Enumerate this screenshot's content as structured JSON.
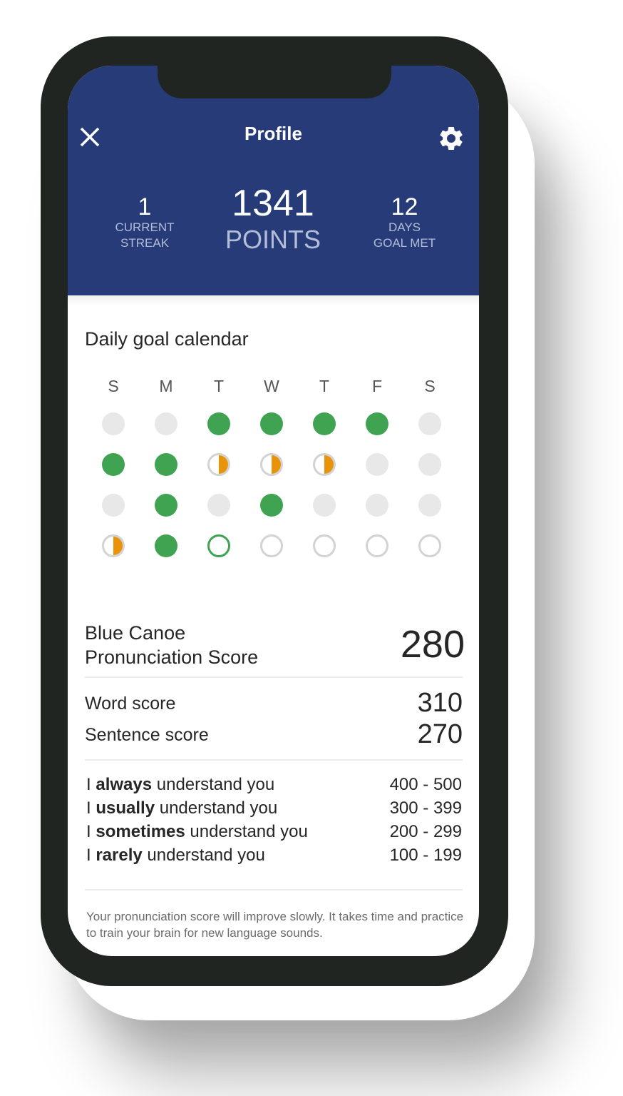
{
  "header": {
    "title": "Profile",
    "close_icon": "close-icon",
    "settings_icon": "gear-icon",
    "background_color": "#263b77"
  },
  "stats": {
    "streak": {
      "value": "1",
      "label_line1": "CURRENT",
      "label_line2": "STREAK"
    },
    "points": {
      "value": "1341",
      "label": "POINTS"
    },
    "days": {
      "value": "12",
      "label_line1": "DAYS",
      "label_line2": "GOAL MET"
    }
  },
  "calendar": {
    "title": "Daily goal calendar",
    "weekdays": [
      "S",
      "M",
      "T",
      "W",
      "T",
      "F",
      "S"
    ],
    "legend_colors": {
      "met": "#3fa352",
      "partial": "#e8930a",
      "empty": "#e8e8e8",
      "future": "#d3d3d3"
    },
    "weeks": [
      [
        "empty",
        "empty",
        "met",
        "met",
        "met",
        "met",
        "empty"
      ],
      [
        "met",
        "met",
        "partial",
        "partial",
        "partial",
        "empty",
        "empty"
      ],
      [
        "empty",
        "met",
        "empty",
        "met",
        "empty",
        "empty",
        "empty"
      ],
      [
        "partial",
        "met",
        "today",
        "future",
        "future",
        "future",
        "future"
      ]
    ]
  },
  "scores": {
    "title_line1": "Blue Canoe",
    "title_line2": "Pronunciation Score",
    "overall": "280",
    "word_label": "Word score",
    "word_value": "310",
    "sentence_label": "Sentence score",
    "sentence_value": "270"
  },
  "levels": [
    {
      "prefix": "I",
      "emphasis": "always",
      "suffix": "understand you",
      "range": "400 - 500"
    },
    {
      "prefix": "I",
      "emphasis": "usually",
      "suffix": "understand you",
      "range": "300 - 399"
    },
    {
      "prefix": "I",
      "emphasis": "sometimes",
      "suffix": "understand you",
      "range": "200 - 299"
    },
    {
      "prefix": "I",
      "emphasis": "rarely",
      "suffix": "understand you",
      "range": "100 - 199"
    }
  ],
  "footnote": "Your pronunciation score will improve slowly. It takes time and practice to train your brain for new language sounds."
}
